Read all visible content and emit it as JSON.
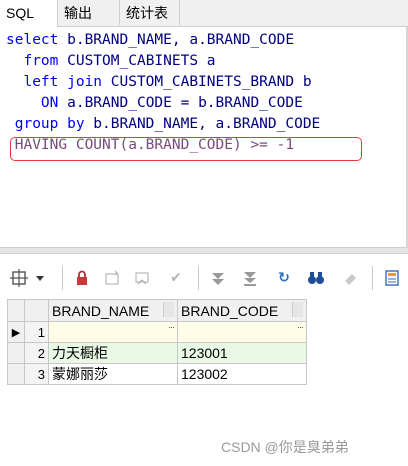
{
  "tabs": [
    {
      "label": "SQL"
    },
    {
      "label": "输出"
    },
    {
      "label": "统计表"
    }
  ],
  "editor": {
    "lines": [
      [
        {
          "t": "select",
          "c": "kw"
        },
        {
          "t": " b.BRAND_NAME, a.BRAND_CODE",
          "c": "id"
        }
      ],
      [
        {
          "t": "  from",
          "c": "kw"
        },
        {
          "t": " CUSTOM_CABINETS a",
          "c": "id"
        }
      ],
      [
        {
          "t": "  left join",
          "c": "kw"
        },
        {
          "t": " CUSTOM_CABINETS_BRAND b",
          "c": "id"
        }
      ],
      [
        {
          "t": "    ON",
          "c": "kw"
        },
        {
          "t": " a.BRAND_CODE = b.BRAND_CODE",
          "c": "id"
        }
      ],
      [
        {
          "t": " group by",
          "c": "kw"
        },
        {
          "t": " b.BRAND_NAME, a.BRAND_CODE",
          "c": "id"
        }
      ],
      [
        {
          "t": " HAVING COUNT(a.BRAND_CODE) >= -1",
          "c": "hl"
        }
      ]
    ]
  },
  "grid": {
    "columns": [
      "BRAND_NAME",
      "BRAND_CODE"
    ],
    "rows": [
      {
        "num": "1",
        "indicator": "▶",
        "brand_name": "",
        "brand_code": ""
      },
      {
        "num": "2",
        "indicator": "",
        "brand_name": "力天橱柜",
        "brand_code": "123001"
      },
      {
        "num": "3",
        "indicator": "",
        "brand_name": "蒙娜丽莎",
        "brand_code": "123002"
      }
    ],
    "cell_button": "···"
  },
  "watermark": "CSDN @你是臭弟弟",
  "colors": {
    "keyword": "#0000ff",
    "identifier": "#000080",
    "highlight_box": "#e63b3b",
    "new_row": "#fffde7",
    "alt_row": "#eaf9e6"
  }
}
